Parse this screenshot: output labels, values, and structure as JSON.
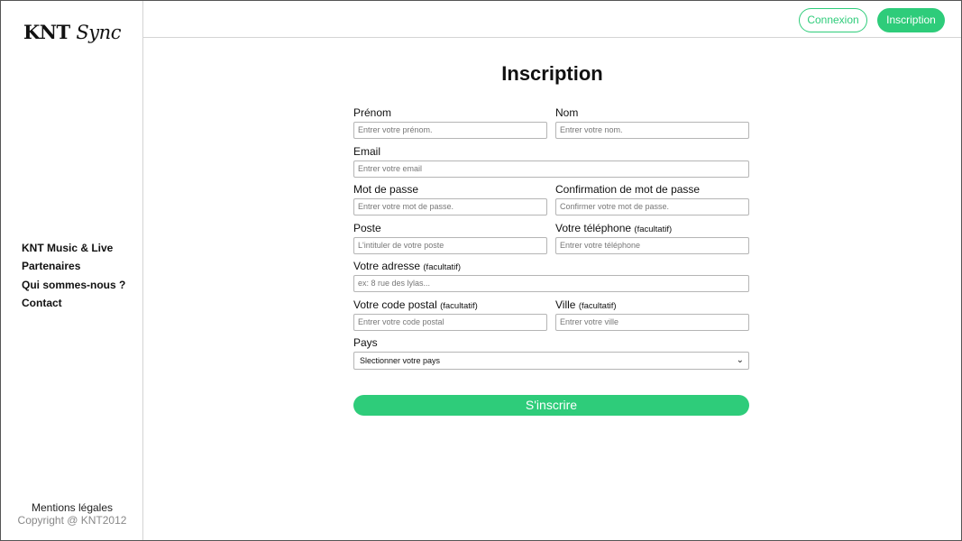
{
  "sidebar": {
    "logo_a": "KNT",
    "logo_b": "Sync",
    "nav": [
      "KNT Music & Live",
      "Partenaires",
      "Qui sommes-nous ?",
      "Contact"
    ],
    "legal": "Mentions légales",
    "copyright": "Copyright @ KNT2012"
  },
  "header": {
    "login_label": "Connexion",
    "signup_label": "Inscription"
  },
  "form": {
    "title": "Inscription",
    "firstname": {
      "label": "Prénom",
      "placeholder": "Entrer votre prénom."
    },
    "lastname": {
      "label": "Nom",
      "placeholder": "Entrer votre nom."
    },
    "email": {
      "label": "Email",
      "placeholder": "Entrer votre email"
    },
    "password": {
      "label": "Mot de passe",
      "placeholder": "Entrer votre mot de passe."
    },
    "password_confirm": {
      "label": "Confirmation de mot de passe",
      "placeholder": "Confirmer votre mot de passe."
    },
    "position": {
      "label": "Poste",
      "placeholder": "L'intituler de votre poste"
    },
    "phone": {
      "label": "Votre téléphone",
      "optional": "(facultatif)",
      "placeholder": "Entrer votre téléphone"
    },
    "address": {
      "label": "Votre adresse",
      "optional": "(facultatif)",
      "placeholder": "ex: 8 rue des lylas..."
    },
    "postal_code": {
      "label": "Votre code postal",
      "optional": "(facultatif)",
      "placeholder": "Entrer votre code postal"
    },
    "city": {
      "label": "Ville",
      "optional": "(facultatif)",
      "placeholder": "Entrer votre ville"
    },
    "country": {
      "label": "Pays",
      "selected": "Slectionner votre pays"
    },
    "submit_label": "S'inscrire"
  },
  "colors": {
    "accent": "#2ecc7a"
  },
  "icons": {
    "select_arrow": "chevron-down-icon"
  }
}
